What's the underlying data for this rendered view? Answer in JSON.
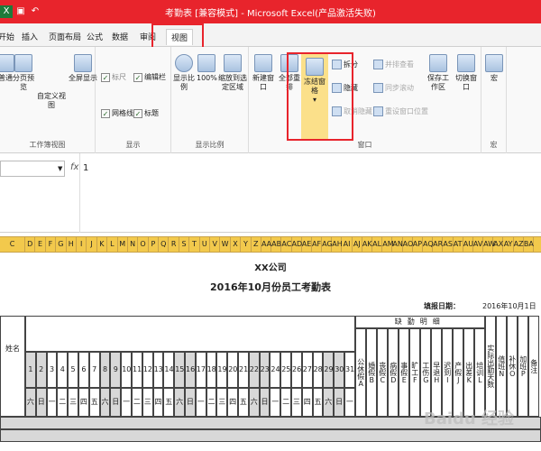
{
  "window": {
    "title": "考勤表 [兼容模式] - Microsoft Excel(产品激活失败)"
  },
  "tabs": [
    "开始",
    "插入",
    "页面布局",
    "公式",
    "数据",
    "审阅",
    "视图"
  ],
  "ribbon": {
    "workbook_views": {
      "label": "工作簿视图",
      "buttons": [
        "普通",
        "分页预览",
        "自定义视图",
        "全屏显示"
      ]
    },
    "show": {
      "label": "显示",
      "checks": [
        "标尺",
        "编辑栏",
        "网格线",
        "标题"
      ]
    },
    "zoom": {
      "label": "显示比例",
      "buttons": [
        "显示比例",
        "100%",
        "缩放到选定区域"
      ]
    },
    "window": {
      "label": "窗口",
      "buttons": [
        "新建窗口",
        "全部重排",
        "冻结窗格"
      ],
      "small": [
        "拆分",
        "隐藏",
        "取消隐藏",
        "并排查看",
        "同步滚动",
        "重设窗口位置"
      ],
      "right": [
        "保存工作区",
        "切换窗口"
      ]
    },
    "macros": {
      "label": "宏",
      "button": "宏"
    }
  },
  "formula_bar": {
    "name_box": "",
    "fx": "fx",
    "value": "1"
  },
  "columns": [
    "C",
    "D",
    "E",
    "F",
    "G",
    "H",
    "I",
    "J",
    "K",
    "L",
    "M",
    "N",
    "O",
    "P",
    "Q",
    "R",
    "S",
    "T",
    "U",
    "V",
    "W",
    "X",
    "Y",
    "Z",
    "AA",
    "AB",
    "AC",
    "AD",
    "AE",
    "AF",
    "AG",
    "AH",
    "AI",
    "AJ",
    "AK",
    "AL",
    "AM",
    "AN",
    "AO",
    "AP",
    "AQ",
    "AR",
    "AS",
    "AT",
    "AU",
    "AV",
    "AW",
    "AX",
    "AY",
    "AZ",
    "BA"
  ],
  "sheet": {
    "company": "XX公司",
    "title": "2016年10月份员工考勤表",
    "fill_date_label": "填报日期：",
    "fill_date_value": "2016年10月1日",
    "name_header": "姓名",
    "days": [
      "1",
      "2",
      "3",
      "4",
      "5",
      "6",
      "7",
      "8",
      "9",
      "10",
      "11",
      "12",
      "13",
      "14",
      "15",
      "16",
      "17",
      "18",
      "19",
      "20",
      "21",
      "22",
      "23",
      "24",
      "25",
      "26",
      "27",
      "28",
      "29",
      "30",
      "31"
    ],
    "weekdays": [
      "六",
      "日",
      "一",
      "二",
      "三",
      "四",
      "五",
      "六",
      "日",
      "一",
      "二",
      "三",
      "四",
      "五",
      "六",
      "日",
      "一",
      "二",
      "三",
      "四",
      "五",
      "六",
      "日",
      "一",
      "二",
      "三",
      "四",
      "五",
      "六",
      "日",
      "一"
    ],
    "absence_group": "缺勤明细",
    "absence_cols": [
      "公休假A",
      "婚假B",
      "丧假C",
      "病假D",
      "事假E",
      "旷工F",
      "工伤G",
      "早退H",
      "迟到I",
      "产假J",
      "出差K",
      "培训L"
    ],
    "extra_cols": [
      "实际出勤天数",
      "值班N",
      "补休O",
      "加班P",
      "备注"
    ]
  },
  "watermark": "Baidu 经验"
}
